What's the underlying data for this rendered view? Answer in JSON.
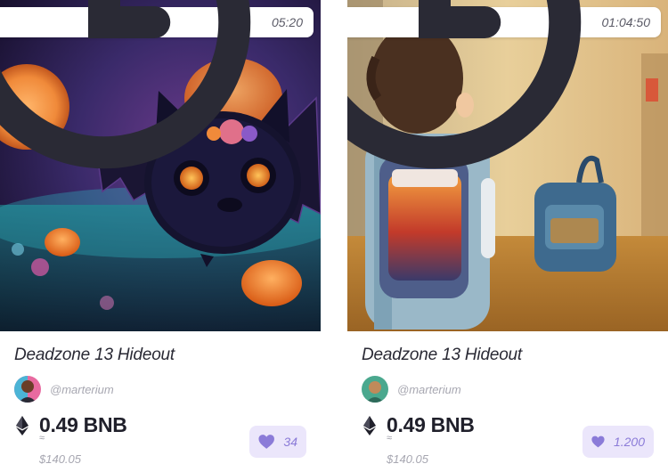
{
  "cards": [
    {
      "timer": "05:20",
      "title": "Deadzone 13 Hideout",
      "creator": "@marterium",
      "price": "0.49 BNB",
      "approx_symbol": "≈",
      "usd_price": "$140.05",
      "likes": "34",
      "image_subject": "black-bat-halloween-artwork",
      "avatar": "creator-avatar"
    },
    {
      "timer": "01:04:50",
      "title": "Deadzone 13 Hideout",
      "creator": "@marterium",
      "price": "0.49 BNB",
      "approx_symbol": "≈",
      "usd_price": "$140.05",
      "likes": "1.200",
      "image_subject": "child-with-backpack-artwork",
      "avatar": "creator-avatar"
    }
  ],
  "colors": {
    "like_background": "#ebe6fb",
    "like_accent": "#8b7bd8",
    "text_primary": "#20202b",
    "text_muted": "#a7a7b1"
  },
  "icons": {
    "timer": "clock-icon",
    "currency": "ethereum-icon",
    "like": "heart-icon"
  }
}
